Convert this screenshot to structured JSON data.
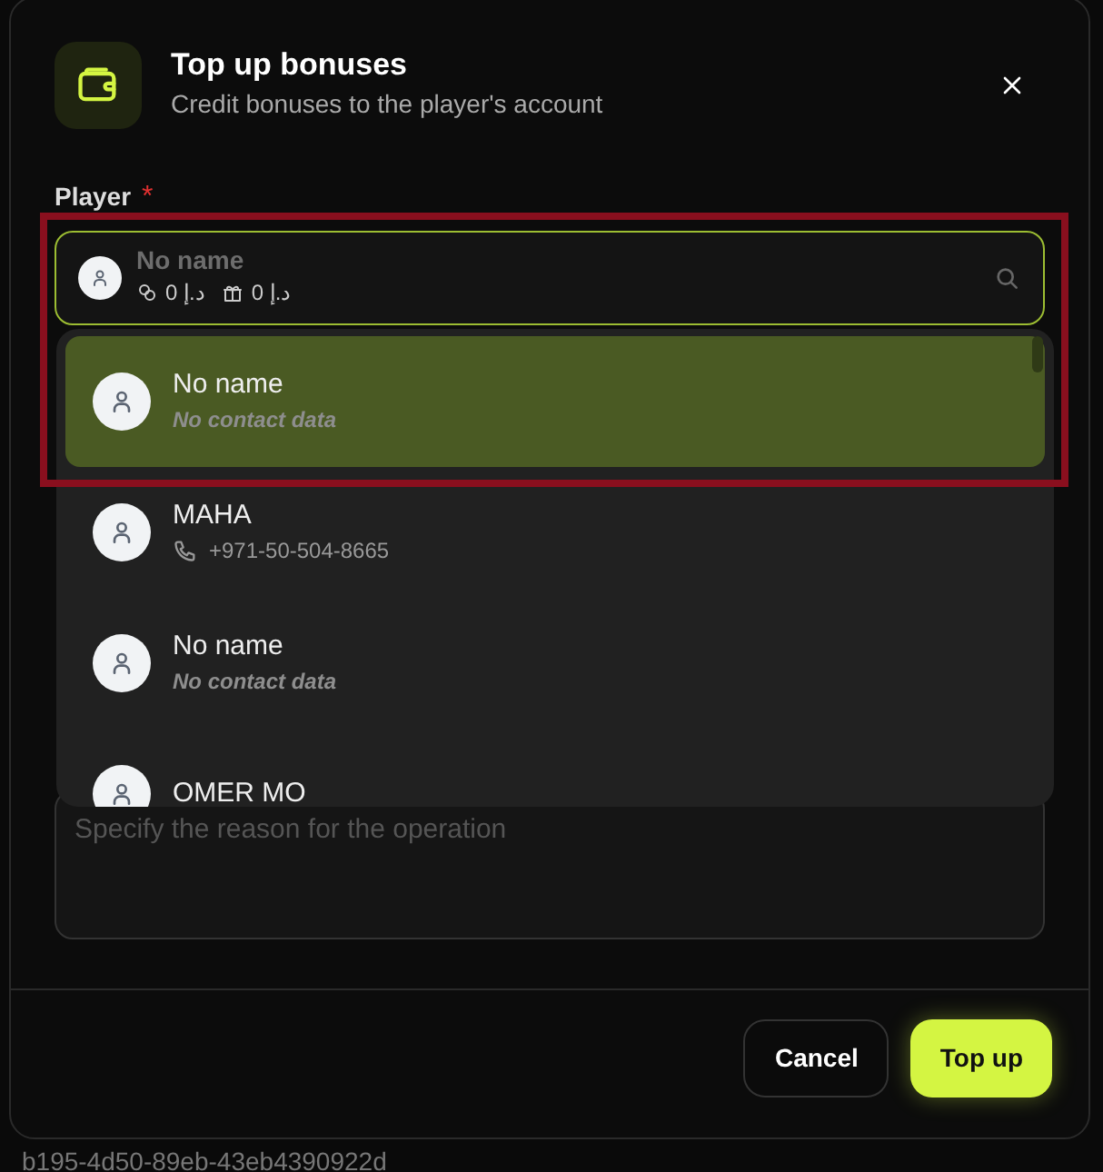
{
  "background": {
    "id_text": "b195-4d50-89eb-43eb4390922d"
  },
  "dialog": {
    "title": "Top up bonuses",
    "subtitle": "Credit bonuses to the player's account"
  },
  "player_field": {
    "label": "Player",
    "required": true,
    "required_mark": "*",
    "highlighted": true,
    "value_name": "No name",
    "bonus_balance": "0 د.إ",
    "gift_balance": "0 د.إ"
  },
  "dropdown": {
    "items": [
      {
        "name": "No name",
        "kind": "empty",
        "detail": "No contact data",
        "selected": true
      },
      {
        "name": "MAHA",
        "kind": "phone",
        "detail": "+971-50-504-8665",
        "selected": false
      },
      {
        "name": "No name",
        "kind": "empty",
        "detail": "No contact data",
        "selected": false
      },
      {
        "name": "OMER MO",
        "kind": "hidden",
        "selected": false
      }
    ]
  },
  "reason_field": {
    "placeholder": "Specify the reason for the operation"
  },
  "buttons": [
    {
      "label": "Cancel",
      "kind": "secondary"
    },
    {
      "label": "Top up",
      "kind": "primary"
    }
  ]
}
